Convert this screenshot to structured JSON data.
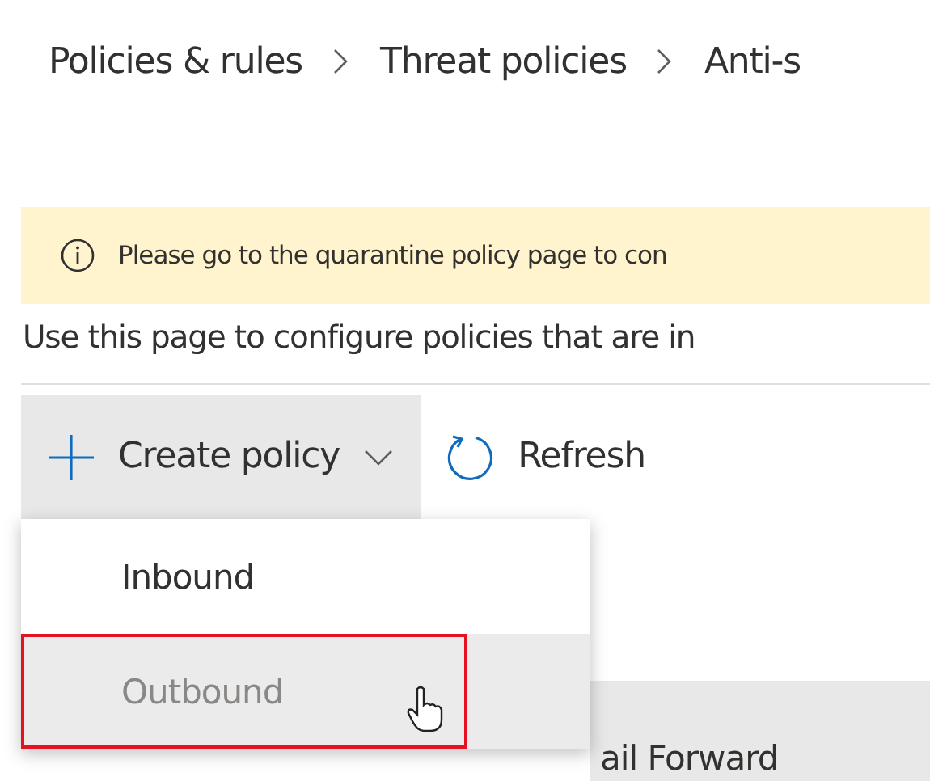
{
  "breadcrumb": [
    "Policies & rules",
    "Threat policies",
    "Anti-s"
  ],
  "banner": {
    "text": "Please go to the quarantine policy page to con"
  },
  "description": "Use this page to configure policies that are in",
  "toolbar": {
    "create_button": "Create policy",
    "refresh_button": "Refresh"
  },
  "menu": {
    "items": [
      {
        "label": "Inbound",
        "highlighted": false
      },
      {
        "label": "Outbound",
        "highlighted": true
      }
    ]
  },
  "table": {
    "row_text": "ail Forward"
  }
}
